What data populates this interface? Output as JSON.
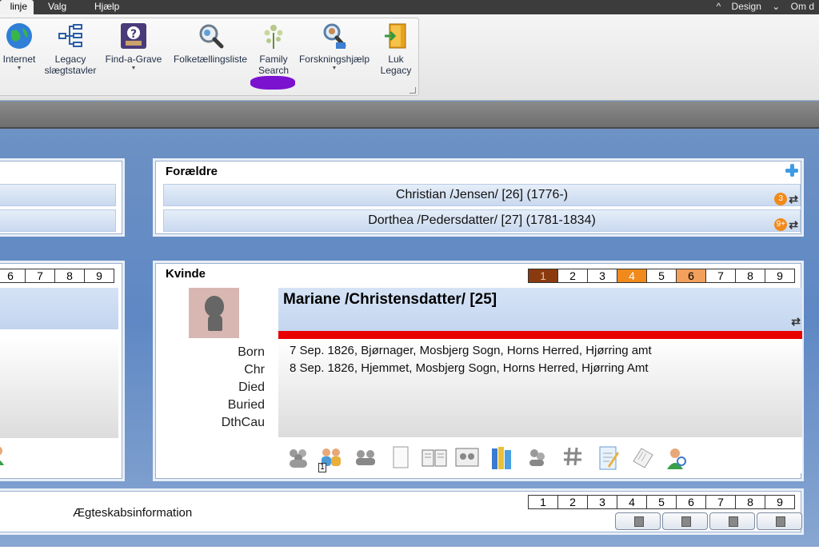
{
  "menubar": {
    "tabs": [
      "linje",
      "Valg",
      "Hjælp"
    ],
    "design": "Design",
    "om": "Om d"
  },
  "ribbon": {
    "buttons": [
      {
        "label1": "Internet",
        "label2": "",
        "icon": "globe-icon",
        "dropdown": true
      },
      {
        "label1": "Legacy",
        "label2": "slægtstavler",
        "icon": "tree-chart-icon",
        "dropdown": false
      },
      {
        "label1": "Find-a-Grave",
        "label2": "",
        "icon": "find-a-grave-icon",
        "dropdown": true
      },
      {
        "label1": "Folketællingsliste",
        "label2": "",
        "icon": "census-search-icon",
        "dropdown": false
      },
      {
        "label1": "Family",
        "label2": "Search",
        "icon": "family-search-icon",
        "dropdown": false
      },
      {
        "label1": "Forskningshjælp",
        "label2": "",
        "icon": "research-help-icon",
        "dropdown": true
      },
      {
        "label1": "Luk",
        "label2": "Legacy",
        "icon": "exit-door-icon",
        "dropdown": false
      }
    ]
  },
  "parents": {
    "title": "Forældre",
    "father": {
      "text": "Christian /Jensen/ [26] (1776-)",
      "badge": "3"
    },
    "mother": {
      "text": "Dorthea /Pedersdatter/ [27] (1781-1834)",
      "badge": "9+"
    }
  },
  "left_tabs": [
    "6",
    "7",
    "8",
    "9"
  ],
  "person": {
    "gender_title": "Kvinde",
    "tabs": [
      "1",
      "2",
      "3",
      "4",
      "5",
      "6",
      "7",
      "8",
      "9"
    ],
    "name": "Mariane /Christensdatter/ [25]",
    "event_labels": [
      "Born",
      "Chr",
      "Died",
      "Buried",
      "DthCau"
    ],
    "events": [
      "7 Sep. 1826, Bjørnager, Mosbjerg Sogn, Horns Herred, Hjørring amt",
      "8 Sep. 1826, Hjemmet, Mosbjerg Sogn, Horns Herred, Hjørring Amt"
    ],
    "toolbar_badge": "1"
  },
  "marriage": {
    "label": "Ægteskabsinformation",
    "tabs": [
      "1",
      "2",
      "3",
      "4",
      "5",
      "6",
      "7",
      "8",
      "9"
    ]
  },
  "colors": {
    "accent_red": "#e80000",
    "badge_orange": "#f08a1c",
    "tab_brown": "#8a3a0e"
  }
}
